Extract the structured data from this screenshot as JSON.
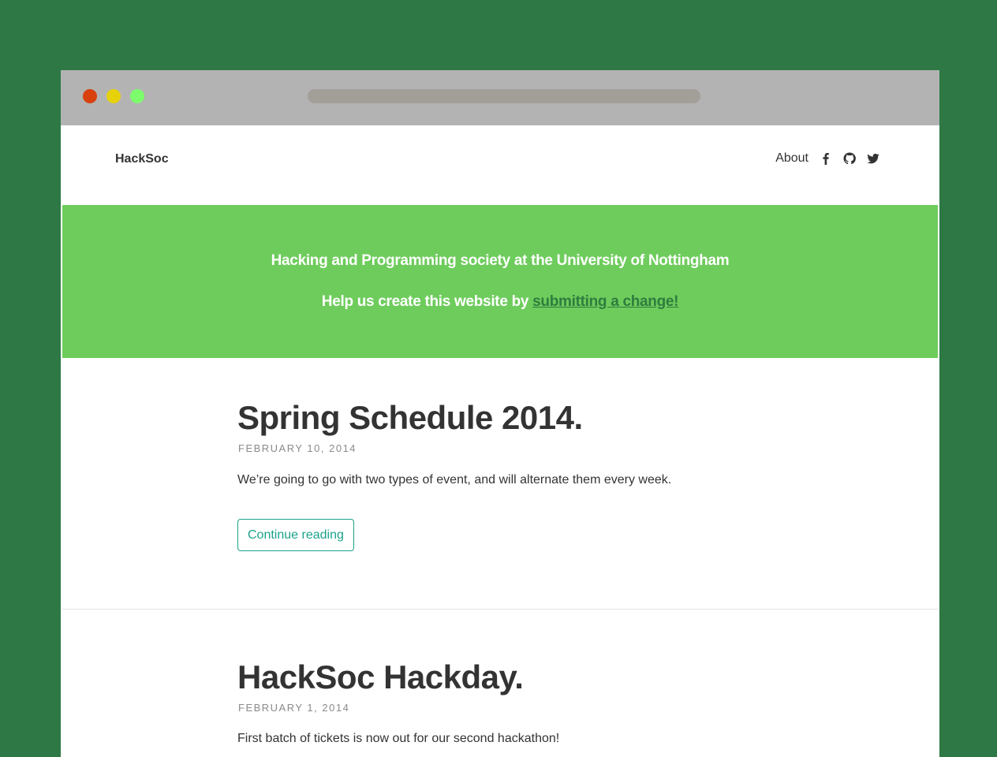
{
  "site": {
    "brand": "HackSoc",
    "nav": {
      "about": "About",
      "icons": [
        "facebook-icon",
        "github-icon",
        "twitter-icon"
      ]
    }
  },
  "hero": {
    "tagline": "Hacking and Programming society at the University of Nottingham",
    "cta_prefix": "Help us create this website by ",
    "cta_link": "submitting a change!"
  },
  "posts": [
    {
      "title": "Spring Schedule 2014.",
      "date": "FEBRUARY 10, 2014",
      "excerpt": "We’re going to go with two types of event, and will alternate them every week.",
      "button": "Continue reading"
    },
    {
      "title": "HackSoc Hackday.",
      "date": "FEBRUARY 1, 2014",
      "excerpt": "First batch of tickets is now out for our second hackathon!"
    }
  ],
  "colors": {
    "background": "#2d7845",
    "hero": "#6ecc5c",
    "accent": "#1aa38a",
    "link": "#2e7d3e"
  }
}
